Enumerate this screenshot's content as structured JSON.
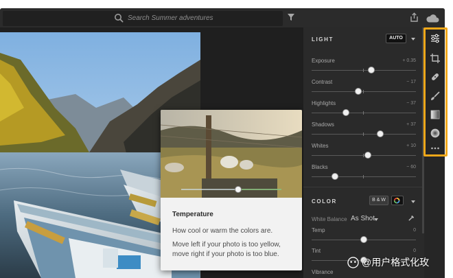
{
  "search": {
    "placeholder": "Search Summer adventures"
  },
  "icons": {
    "search": "search-icon",
    "filter": "filter-icon",
    "share": "share-icon",
    "cloud": "cloud-icon",
    "edit": "edit-sliders-icon",
    "crop": "crop-icon",
    "heal": "bandage-icon",
    "brush": "brush-icon",
    "gradient": "linear-gradient-icon",
    "radial": "radial-gradient-icon",
    "more": "more-icon"
  },
  "tooltip": {
    "title": "Temperature",
    "line1": "How cool or warm the colors are.",
    "line2": "Move left if your photo is too yellow,",
    "line3": "move right if your photo is too blue.",
    "slider_position": 0.56
  },
  "light": {
    "title": "LIGHT",
    "auto_label": "AUTO",
    "sliders": [
      {
        "label": "Exposure",
        "value": "+ 0.35",
        "position": 0.57
      },
      {
        "label": "Contrast",
        "value": "− 17",
        "position": 0.445
      },
      {
        "label": "Highlights",
        "value": "− 37",
        "position": 0.33
      },
      {
        "label": "Shadows",
        "value": "+ 37",
        "position": 0.66
      },
      {
        "label": "Whites",
        "value": "+ 10",
        "position": 0.54
      },
      {
        "label": "Blacks",
        "value": "− 60",
        "position": 0.225
      }
    ]
  },
  "color": {
    "title": "COLOR",
    "bw_label": "B & W",
    "white_balance_label": "White Balance",
    "white_balance_value": "As Shot",
    "sliders": [
      {
        "label": "Temp",
        "value": "0",
        "position": 0.5
      },
      {
        "label": "Tint",
        "value": "0",
        "position": 0.5
      },
      {
        "label": "Vibrance",
        "value": "",
        "position": 0.5
      }
    ]
  },
  "watermark": {
    "text": "@用户格式化玫"
  },
  "colors": {
    "highlight": "#f2a819",
    "panel": "#2a2a2a",
    "background": "#1f1f1f"
  }
}
